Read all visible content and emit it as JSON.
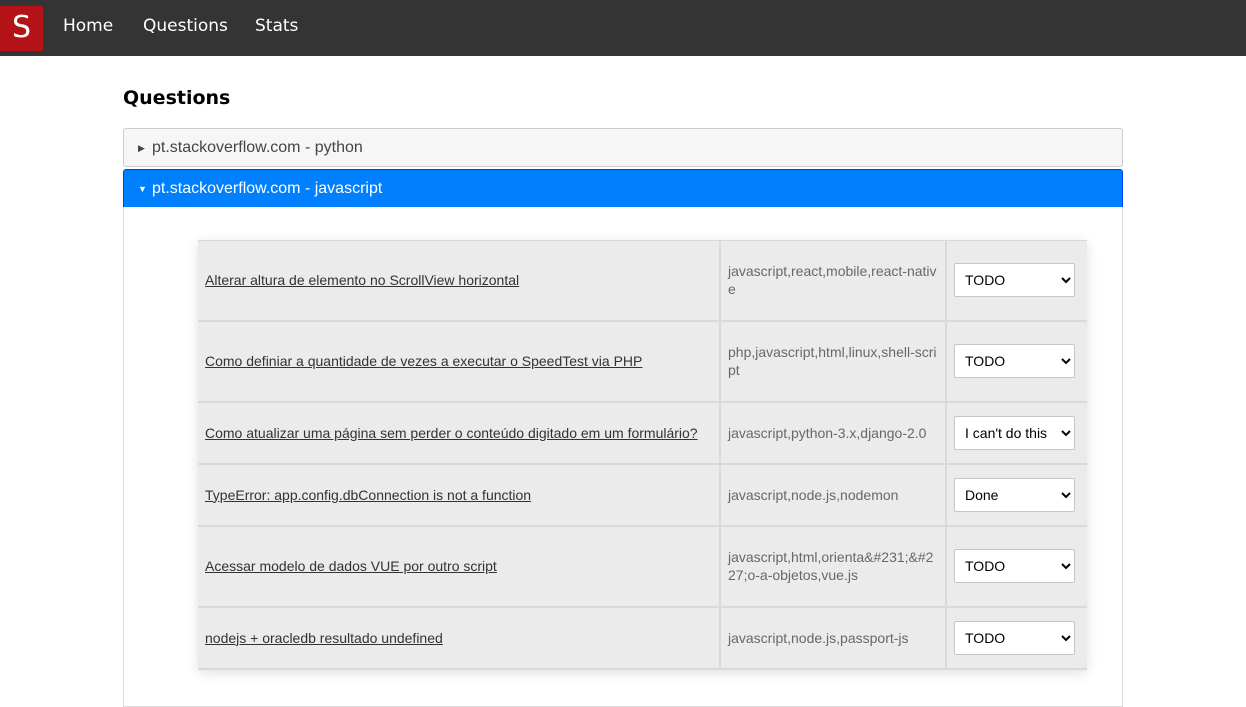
{
  "nav": {
    "logo": "S",
    "links": [
      "Home",
      "Questions",
      "Stats"
    ]
  },
  "page": {
    "title": "Questions"
  },
  "accordion": [
    {
      "label": "pt.stackoverflow.com - python",
      "expanded": false
    },
    {
      "label": "pt.stackoverflow.com - javascript",
      "expanded": true
    }
  ],
  "status_options": [
    "TODO",
    "I can't do this",
    "Done"
  ],
  "questions": [
    {
      "title": "Alterar altura de elemento no ScrollView horizontal",
      "tags": "javascript,react,mobile,react-native",
      "status": "TODO"
    },
    {
      "title": "Como definiar a quantidade de vezes a executar o SpeedTest via PHP",
      "tags": "php,javascript,html,linux,shell-script",
      "status": "TODO"
    },
    {
      "title": "Como atualizar uma página sem perder o conteúdo digitado em um formulário?",
      "tags": "javascript,python-3.x,django-2.0",
      "status": "I can't do this"
    },
    {
      "title": "TypeError: app.config.dbConnection is not a function",
      "tags": "javascript,node.js,nodemon",
      "status": "Done"
    },
    {
      "title": "Acessar modelo de dados VUE por outro script",
      "tags": "javascript,html,orienta&#231;&#227;o-a-objetos,vue.js",
      "status": "TODO"
    },
    {
      "title": "nodejs + oracledb resultado undefined",
      "tags": "javascript,node.js,passport-js",
      "status": "TODO"
    }
  ],
  "colors": {
    "navbar": "#343434",
    "logo": "#b31217",
    "active_header": "#007fff",
    "row": "#ebebeb"
  }
}
